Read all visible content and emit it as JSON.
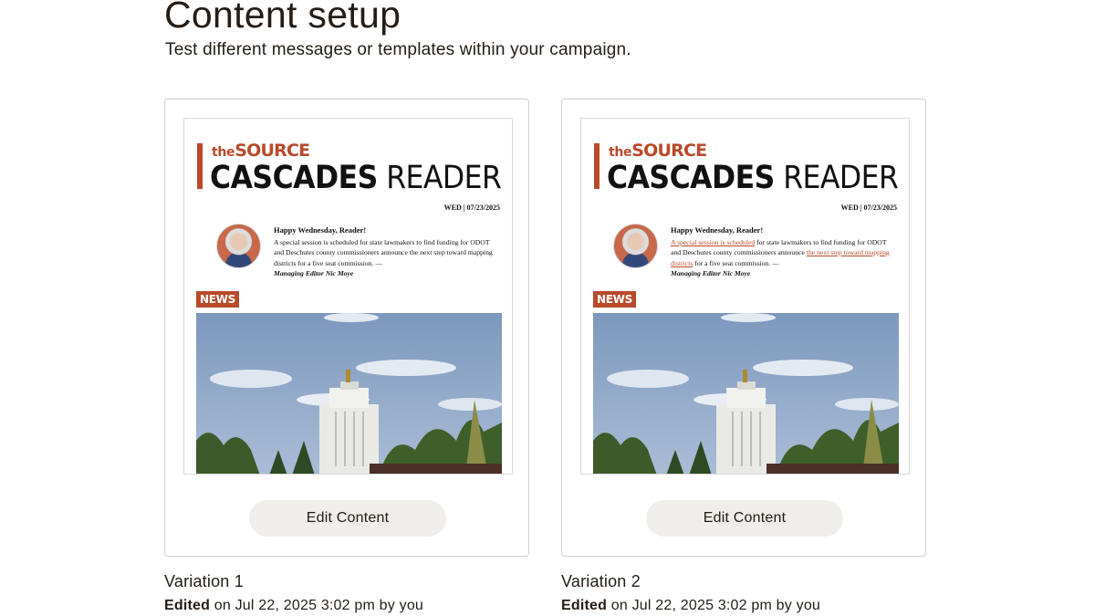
{
  "header": {
    "title": "Content setup",
    "subtitle": "Test different messages or templates within your campaign."
  },
  "variations": [
    {
      "name": "Variation 1",
      "edited_label": "Edited",
      "edited_detail": "on Jul 22, 2025 3:02 pm by you",
      "button_label": "Edit Content",
      "preview": {
        "brand_the": "the",
        "brand_source": "SOURCE",
        "brand_bold": "CASCADES",
        "brand_light": "READER",
        "date": "WED | 07/23/2025",
        "greeting": "Happy Wednesday, Reader!",
        "body_link_1": "",
        "body_text_1": "A special session is scheduled for state lawmakers to find funding for ODOT and Deschutes county commissioners announce the next step toward mapping districts",
        "body_link_2": "",
        "body_text_2": " for a five seat commission. —",
        "signature": "Managing Editor Nic Moye",
        "tag": "NEWS"
      }
    },
    {
      "name": "Variation 2",
      "edited_label": "Edited",
      "edited_detail": "on Jul 22, 2025 3:02 pm by you",
      "button_label": "Edit Content",
      "preview": {
        "brand_the": "the",
        "brand_source": "SOURCE",
        "brand_bold": "CASCADES",
        "brand_light": "READER",
        "date": "WED | 07/23/2025",
        "greeting": "Happy Wednesday, Reader!",
        "body_link_1": "A special session is scheduled",
        "body_text_1": " for state lawmakers to find funding for ODOT and Deschutes county commissioners announce ",
        "body_link_2": "the next step toward mapping districts",
        "body_text_2": " for a five seat commission. —",
        "signature": "Managing Editor Nic Moye",
        "tag": "NEWS"
      }
    }
  ],
  "colors": {
    "brand_accent": "#b84a2a",
    "button_bg": "#efeeea",
    "text": "#241c15"
  }
}
